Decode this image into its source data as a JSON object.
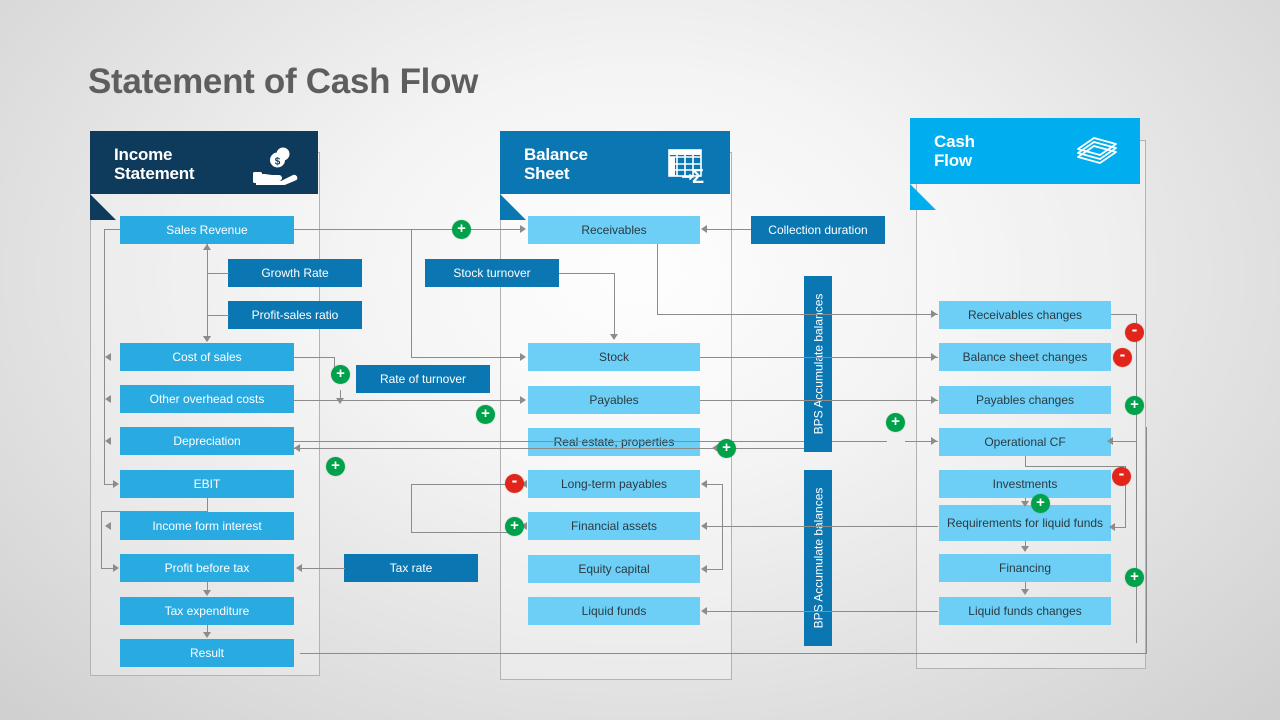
{
  "page_title": "Statement of Cash Flow",
  "colors": {
    "income_header": "#0e3a5c",
    "balance_header": "#0b77b2",
    "cashflow_header": "#00aeef",
    "income_node": "#29abe2",
    "balance_node": "#6dcff6",
    "driver_node": "#0b77b2",
    "plus_badge": "#00a14b",
    "minus_badge": "#e1251b",
    "connector": "#8c8c8c"
  },
  "columns": [
    {
      "key": "income",
      "title": "Income\nStatement",
      "icon": "hand-with-coin-icon"
    },
    {
      "key": "balance",
      "title": "Balance\nSheet",
      "icon": "spreadsheet-sum-icon"
    },
    {
      "key": "cashflow",
      "title": "Cash\nFlow",
      "icon": "cash-stack-icon"
    }
  ],
  "income_nodes": [
    "Sales Revenue",
    "Cost of sales",
    "Other overhead costs",
    "Depreciation",
    "EBIT",
    "Income form interest",
    "Profit before tax",
    "Tax expenditure",
    "Result"
  ],
  "income_drivers": [
    "Growth Rate",
    "Profit-sales ratio",
    "Tax rate"
  ],
  "balance_nodes": [
    "Receivables",
    "Stock",
    "Payables",
    "Real estate, properties",
    "Long-term payables",
    "Financial assets",
    "Equity capital",
    "Liquid funds"
  ],
  "balance_drivers": [
    "Stock turnover",
    "Rate of turnover",
    "Collection duration"
  ],
  "cashflow_nodes": [
    "Receivables changes",
    "Balance sheet changes",
    "Payables changes",
    "Operational CF",
    "Investments",
    "Requirements for liquid funds",
    "Financing",
    "Liquid funds changes"
  ],
  "accumulators": [
    "BPS Accumulate balances",
    "BPS Accumulate balances"
  ],
  "badges": [
    {
      "sign": "+",
      "name": "plus-badge-sales-to-receivables"
    },
    {
      "sign": "+",
      "name": "plus-badge-cost-of-sales"
    },
    {
      "sign": "+",
      "name": "plus-badge-payables"
    },
    {
      "sign": "+",
      "name": "plus-badge-real-estate"
    },
    {
      "sign": "+",
      "name": "plus-badge-depreciation"
    },
    {
      "sign": "-",
      "name": "minus-badge-long-term-payables"
    },
    {
      "sign": "+",
      "name": "plus-badge-financial-assets"
    },
    {
      "sign": "+",
      "name": "plus-badge-accumulate-operational"
    },
    {
      "sign": "-",
      "name": "minus-badge-receivables-changes"
    },
    {
      "sign": "-",
      "name": "minus-badge-balance-sheet-changes"
    },
    {
      "sign": "+",
      "name": "plus-badge-payables-changes"
    },
    {
      "sign": "-",
      "name": "minus-badge-investments"
    },
    {
      "sign": "+",
      "name": "plus-badge-requirements"
    },
    {
      "sign": "+",
      "name": "plus-badge-financing"
    }
  ]
}
